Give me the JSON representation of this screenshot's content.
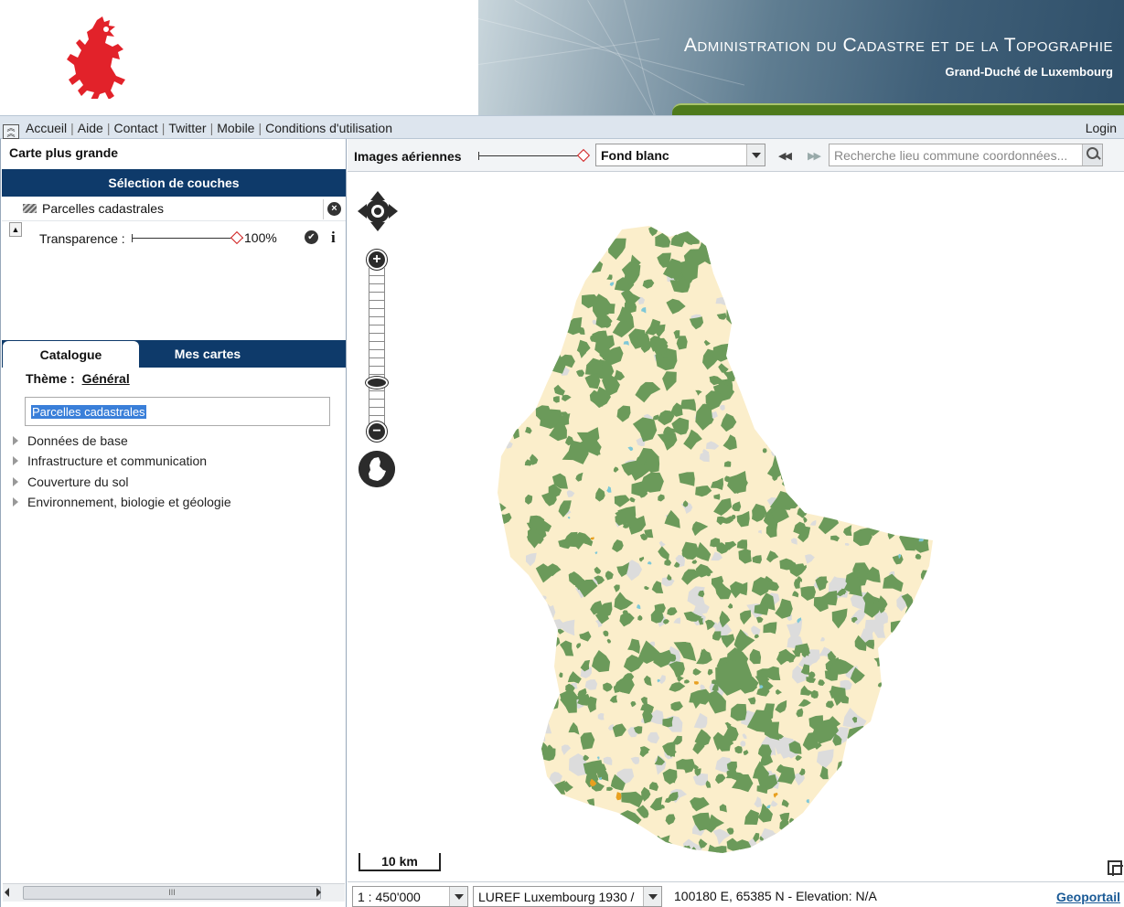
{
  "header": {
    "title": "Administration du Cadastre et de la Topographie",
    "subtitle": "Grand-Duché de Luxembourg",
    "logo_icon": "red-lion-icon",
    "accent_green": "#4e7a1c",
    "lion_color": "#e2222a"
  },
  "nav": {
    "links": [
      "Accueil",
      "Aide",
      "Contact",
      "Twitter",
      "Mobile",
      "Conditions d'utilisation"
    ],
    "login": "Login"
  },
  "left_panel": {
    "bigger_map": "Carte plus grande",
    "layers_header": "Sélection de couches",
    "layer": {
      "name": "Parcelles cadastrales",
      "transparency_label": "Transparence :",
      "transparency_value": "100%"
    },
    "tabs": [
      "Catalogue",
      "Mes cartes"
    ],
    "theme_label": "Thème :",
    "theme_value": "Général",
    "search_selected_text": "Parcelles cadastrales",
    "tree": [
      "Données de base",
      "Infrastructure et communication",
      "Couverture du sol",
      "Environnement, biologie et géologie"
    ],
    "scroll_thumb_mark": "III"
  },
  "map_toolbar": {
    "aerial_label": "Images aériennes",
    "background_select": "Fond blanc",
    "search_placeholder": "Recherche lieu commune coordonnées..."
  },
  "map": {
    "scalebar": "10 km",
    "colors": {
      "land": "#fbeecb",
      "forest": "#6b9a5a",
      "urban": "#dcdcdc",
      "water": "#7ec8d8",
      "highlight": "#e8a020"
    }
  },
  "status": {
    "scale": "1 : 450'000",
    "projection": "LUREF Luxembourg 1930 /",
    "coords": "100180 E, 65385 N  - Elevation: N/A",
    "geoportail": "Geoportail"
  }
}
